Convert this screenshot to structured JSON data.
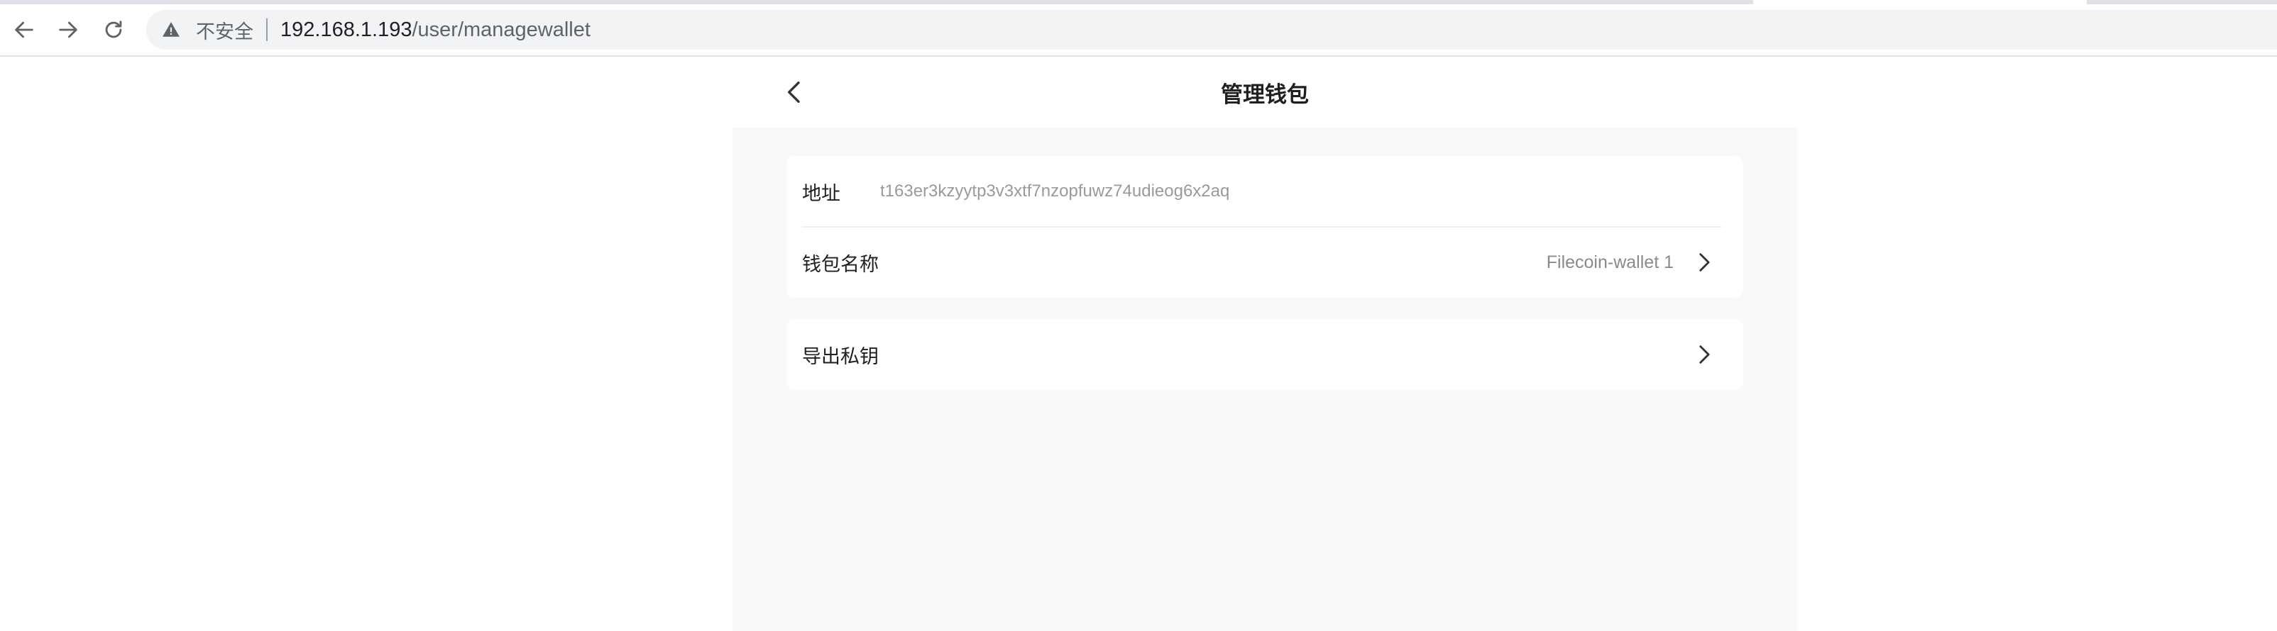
{
  "browser": {
    "security_label": "不安全",
    "url_host": "192.168.1.193",
    "url_path": "/user/managewallet"
  },
  "page": {
    "title": "管理钱包",
    "wallet_info": {
      "address_label": "地址",
      "address_value": "t163er3kzyytp3v3xtf7nzopfuwz74udieog6x2aq",
      "name_label": "钱包名称",
      "name_value": "Filecoin-wallet 1"
    },
    "export": {
      "label": "导出私钥"
    }
  },
  "icons": {
    "back": "chevron-left-icon",
    "forward": "arrow-right-icon",
    "reload": "reload-icon",
    "warning": "warning-triangle-icon",
    "row_chevron": "chevron-right-icon"
  }
}
